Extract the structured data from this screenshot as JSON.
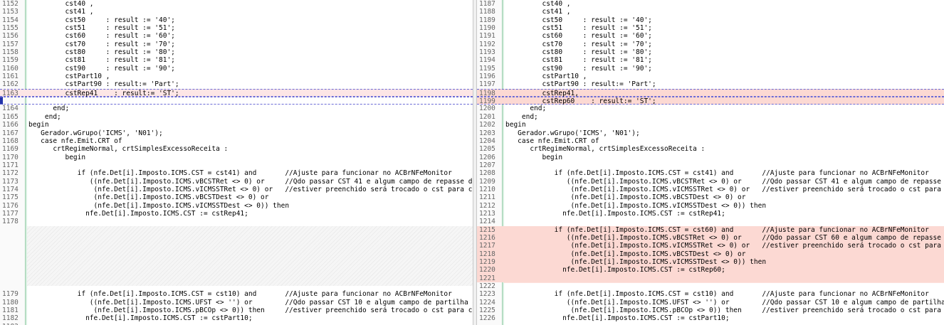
{
  "left": {
    "lines": [
      {
        "n": "1152",
        "t": "         cst40 ,"
      },
      {
        "n": "1153",
        "t": "         cst41 ,"
      },
      {
        "n": "1154",
        "t": "         cst50     : result := '40';"
      },
      {
        "n": "1155",
        "t": "         cst51     : result := '51';"
      },
      {
        "n": "1156",
        "t": "         cst60     : result := '60';"
      },
      {
        "n": "1157",
        "t": "         cst70     : result := '70';"
      },
      {
        "n": "1158",
        "t": "         cst80     : result := '80';"
      },
      {
        "n": "1159",
        "t": "         cst81     : result := '81';"
      },
      {
        "n": "1160",
        "t": "         cst90     : result := '90';"
      },
      {
        "n": "1161",
        "t": "         cstPart10 ,"
      },
      {
        "n": "1162",
        "t": "         cstPart90 : result:= 'Part';"
      },
      {
        "n": "1163",
        "t": "         cstRep41    : result:= 'ST';"
      },
      {
        "n": "",
        "t": ""
      },
      {
        "n": "1164",
        "t": "      end;"
      },
      {
        "n": "1165",
        "t": "    end;"
      },
      {
        "n": "1166",
        "t": "begin"
      },
      {
        "n": "1167",
        "t": "   Gerador.wGrupo('ICMS', 'N01');"
      },
      {
        "n": "1168",
        "t": "   case nfe.Emit.CRT of"
      },
      {
        "n": "1169",
        "t": "      crtRegimeNormal, crtSimplesExcessoReceita :"
      },
      {
        "n": "1170",
        "t": "         begin"
      },
      {
        "n": "1171",
        "t": ""
      },
      {
        "n": "1172",
        "t": "            if (nfe.Det[i].Imposto.ICMS.CST = cst41) and       //Ajuste para funcionar no ACBrNFeMonitor"
      },
      {
        "n": "1173",
        "t": "               ((nfe.Det[i].Imposto.ICMS.vBCSTRet <> 0) or     //Qdo passar CST 41 e algum campo de repasse de"
      },
      {
        "n": "1174",
        "t": "                (nfe.Det[i].Imposto.ICMS.vICMSSTRet <> 0) or   //estiver preenchido será trocado o cst para cs"
      },
      {
        "n": "1175",
        "t": "                (nfe.Det[i].Imposto.ICMS.vBCSTDest <> 0) or"
      },
      {
        "n": "1176",
        "t": "                (nfe.Det[i].Imposto.ICMS.vICMSSTDest <> 0)) then"
      },
      {
        "n": "1177",
        "t": "              nfe.Det[i].Imposto.ICMS.CST := cstRep41;"
      },
      {
        "n": "1178",
        "t": ""
      },
      {
        "n": "",
        "t": ""
      },
      {
        "n": "",
        "t": ""
      },
      {
        "n": "",
        "t": ""
      },
      {
        "n": "",
        "t": ""
      },
      {
        "n": "",
        "t": ""
      },
      {
        "n": "",
        "t": ""
      },
      {
        "n": "",
        "t": ""
      },
      {
        "n": "",
        "t": ""
      },
      {
        "n": "1179",
        "t": "            if (nfe.Det[i].Imposto.ICMS.CST = cst10) and       //Ajuste para funcionar no ACBrNFeMonitor"
      },
      {
        "n": "1180",
        "t": "               ((nfe.Det[i].Imposto.ICMS.UFST <> '') or        //Qdo passar CST 10 e algum campo de partilha d"
      },
      {
        "n": "1181",
        "t": "                (nfe.Det[i].Imposto.ICMS.pBCOp <> 0)) then     //estiver preenchido será trocado o cst para cs"
      },
      {
        "n": "1182",
        "t": "              nfe.Det[i].Imposto.ICMS.CST := cstPart10;"
      },
      {
        "n": "1183",
        "t": ""
      }
    ]
  },
  "right": {
    "lines": [
      {
        "n": "1187",
        "t": "         cst40 ,"
      },
      {
        "n": "1188",
        "t": "         cst41 ,"
      },
      {
        "n": "1189",
        "t": "         cst50     : result := '40';"
      },
      {
        "n": "1190",
        "t": "         cst51     : result := '51';"
      },
      {
        "n": "1191",
        "t": "         cst60     : result := '60';"
      },
      {
        "n": "1192",
        "t": "         cst70     : result := '70';"
      },
      {
        "n": "1193",
        "t": "         cst80     : result := '80';"
      },
      {
        "n": "1194",
        "t": "         cst81     : result := '81';"
      },
      {
        "n": "1195",
        "t": "         cst90     : result := '90';"
      },
      {
        "n": "1196",
        "t": "         cstPart10 ,"
      },
      {
        "n": "1197",
        "t": "         cstPart90 : result:= 'Part';"
      },
      {
        "n": "1198",
        "t": "         cstRep41,"
      },
      {
        "n": "1199",
        "t": "         cstRep60    : result:= 'ST';"
      },
      {
        "n": "1200",
        "t": "      end;"
      },
      {
        "n": "1201",
        "t": "    end;"
      },
      {
        "n": "1202",
        "t": "begin"
      },
      {
        "n": "1203",
        "t": "   Gerador.wGrupo('ICMS', 'N01');"
      },
      {
        "n": "1204",
        "t": "   case nfe.Emit.CRT of"
      },
      {
        "n": "1205",
        "t": "      crtRegimeNormal, crtSimplesExcessoReceita :"
      },
      {
        "n": "1206",
        "t": "         begin"
      },
      {
        "n": "1207",
        "t": ""
      },
      {
        "n": "1208",
        "t": "            if (nfe.Det[i].Imposto.ICMS.CST = cst41) and       //Ajuste para funcionar no ACBrNFeMonitor"
      },
      {
        "n": "1209",
        "t": "               ((nfe.Det[i].Imposto.ICMS.vBCSTRet <> 0) or     //Qdo passar CST 41 e algum campo de repasse d"
      },
      {
        "n": "1210",
        "t": "                (nfe.Det[i].Imposto.ICMS.vICMSSTRet <> 0) or   //estiver preenchido será trocado o cst para c"
      },
      {
        "n": "1211",
        "t": "                (nfe.Det[i].Imposto.ICMS.vBCSTDest <> 0) or"
      },
      {
        "n": "1212",
        "t": "                (nfe.Det[i].Imposto.ICMS.vICMSSTDest <> 0)) then"
      },
      {
        "n": "1213",
        "t": "              nfe.Det[i].Imposto.ICMS.CST := cstRep41;"
      },
      {
        "n": "1214",
        "t": ""
      },
      {
        "n": "1215",
        "t": "            if (nfe.Det[i].Imposto.ICMS.CST = cst60) and       //Ajuste para funcionar no ACBrNFeMonitor"
      },
      {
        "n": "1216",
        "t": "               ((nfe.Det[i].Imposto.ICMS.vBCSTRet <> 0) or     //Qdo passar CST 60 e algum campo de repasse d"
      },
      {
        "n": "1217",
        "t": "                (nfe.Det[i].Imposto.ICMS.vICMSSTRet <> 0) or   //estiver preenchido será trocado o cst para c"
      },
      {
        "n": "1218",
        "t": "                (nfe.Det[i].Imposto.ICMS.vBCSTDest <> 0) or"
      },
      {
        "n": "1219",
        "t": "                (nfe.Det[i].Imposto.ICMS.vICMSSTDest <> 0)) then"
      },
      {
        "n": "1220",
        "t": "              nfe.Det[i].Imposto.ICMS.CST := cstRep60;"
      },
      {
        "n": "1221",
        "t": ""
      },
      {
        "n": "1222",
        "t": ""
      },
      {
        "n": "1223",
        "t": "            if (nfe.Det[i].Imposto.ICMS.CST = cst10) and       //Ajuste para funcionar no ACBrNFeMonitor"
      },
      {
        "n": "1224",
        "t": "               ((nfe.Det[i].Imposto.ICMS.UFST <> '') or        //Qdo passar CST 10 e algum campo de partilha"
      },
      {
        "n": "1225",
        "t": "                (nfe.Det[i].Imposto.ICMS.pBCOp <> 0)) then     //estiver preenchido será trocado o cst para c"
      },
      {
        "n": "1226",
        "t": "              nfe.Det[i].Imposto.ICMS.CST := cstPart10;"
      }
    ]
  }
}
